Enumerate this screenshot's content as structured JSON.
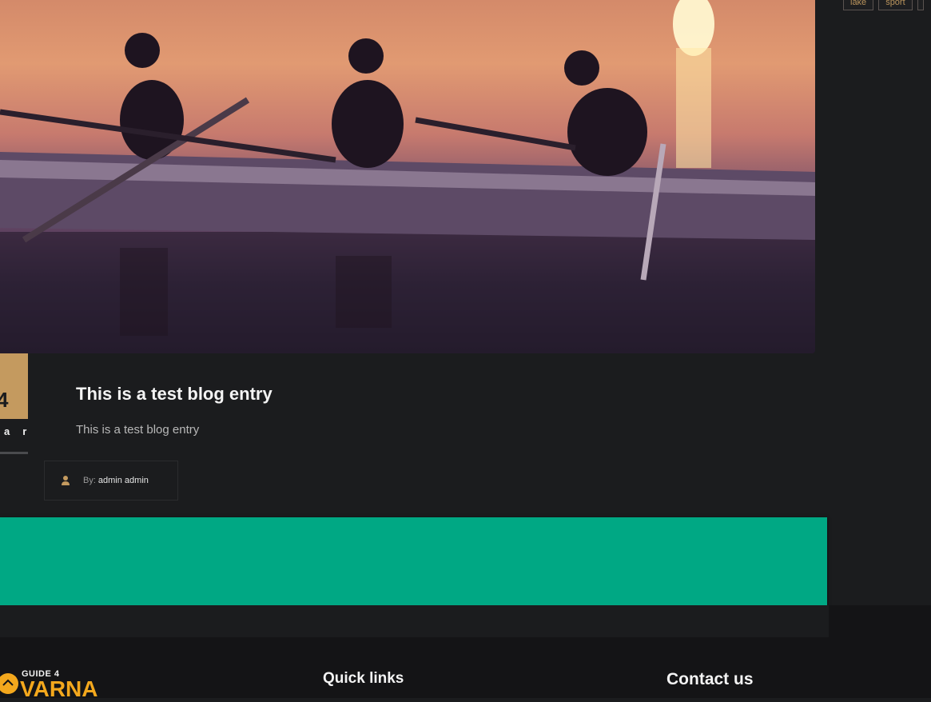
{
  "tags": [
    "lake",
    "sport"
  ],
  "post": {
    "date_day": "4",
    "date_month": "ar",
    "title": "This is a test blog entry",
    "excerpt": "This is a test blog entry",
    "author_label": "By:",
    "author_name": "admin admin"
  },
  "footer": {
    "logo_top": "GUIDE 4",
    "logo_main": "VARNA",
    "quick_links_heading": "Quick links",
    "contact_heading": "Contact us"
  },
  "colors": {
    "accent": "#c49a5f",
    "banner": "#00a884",
    "logo": "#f4a81d"
  }
}
